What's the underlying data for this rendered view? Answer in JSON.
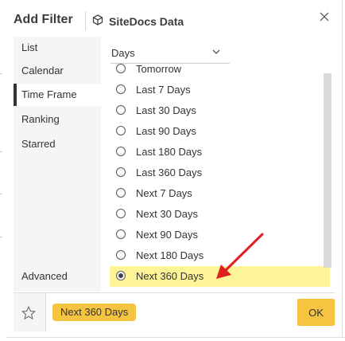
{
  "dialog": {
    "title": "Add Filter",
    "data_source": "SiteDocs Data",
    "data_source_icon": "cube-icon",
    "close_icon": "close-icon"
  },
  "sidebar": {
    "items": [
      {
        "label": "List",
        "active": false
      },
      {
        "label": "Calendar",
        "active": false
      },
      {
        "label": "Time Frame",
        "active": true
      },
      {
        "label": "Ranking",
        "active": false
      },
      {
        "label": "Starred",
        "active": false
      },
      {
        "label": "Advanced",
        "active": false
      }
    ]
  },
  "granularity_select": {
    "value": "Days",
    "icon": "chevron-down-icon"
  },
  "timeframes": {
    "options": [
      {
        "label": "Tomorrow",
        "selected": false
      },
      {
        "label": "Last 7 Days",
        "selected": false
      },
      {
        "label": "Last 30 Days",
        "selected": false
      },
      {
        "label": "Last 90 Days",
        "selected": false
      },
      {
        "label": "Last 180 Days",
        "selected": false
      },
      {
        "label": "Last 360 Days",
        "selected": false
      },
      {
        "label": "Next 7 Days",
        "selected": false
      },
      {
        "label": "Next 30 Days",
        "selected": false
      },
      {
        "label": "Next 90 Days",
        "selected": false
      },
      {
        "label": "Next 180 Days",
        "selected": false
      },
      {
        "label": "Next 360 Days",
        "selected": true
      }
    ]
  },
  "footer": {
    "star_icon": "star-icon",
    "selected_chip": "Next 360 Days",
    "ok_label": "OK"
  },
  "colors": {
    "accent": "#f5c441",
    "selected_row": "#fef599",
    "annotation_arrow": "#e02020"
  }
}
